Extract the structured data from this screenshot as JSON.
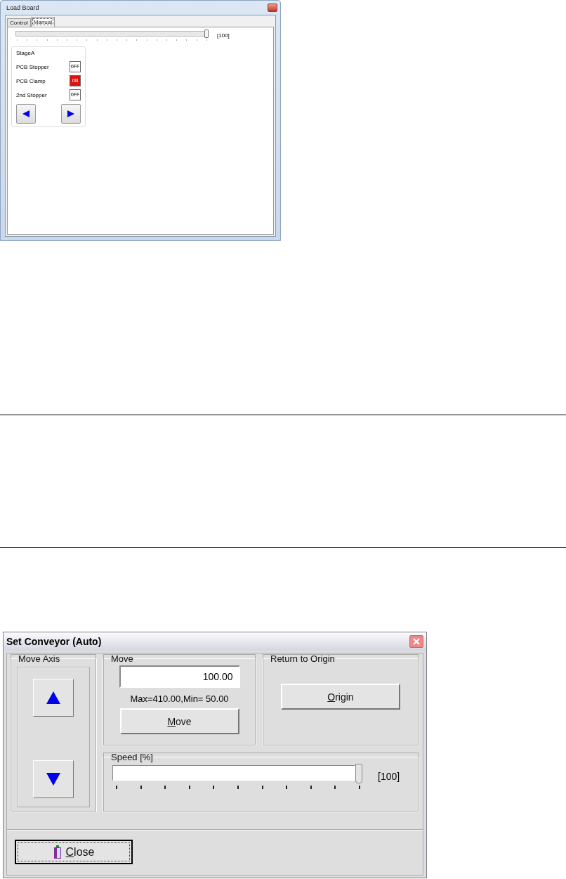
{
  "load_board": {
    "title": "Load Board",
    "tabs": [
      {
        "label": "Control",
        "selected": false
      },
      {
        "label": "Manual",
        "selected": true
      }
    ],
    "speed": {
      "level": 1.0,
      "reading": "[100]"
    },
    "stage": {
      "title": "StageA",
      "switches": [
        {
          "name": "PCB Stopper",
          "label": "OFF",
          "on": false
        },
        {
          "name": "PCB Clamp",
          "label": "ON",
          "on": true
        },
        {
          "name": "2nd Stopper",
          "label": "OFF",
          "on": false
        }
      ]
    }
  },
  "set_conveyor": {
    "title": "Set Conveyor (Auto)",
    "move_axis": {
      "title": "Move Axis"
    },
    "move": {
      "title": "Move",
      "value": "100.00",
      "range": "Max=410.00,Min= 50.00",
      "button": "Move"
    },
    "origin": {
      "title": "Return to  Origin",
      "button": "Origin"
    },
    "speed": {
      "title": "Speed [%]",
      "level": 1.0,
      "reading": "[100]"
    },
    "close": "Close"
  }
}
